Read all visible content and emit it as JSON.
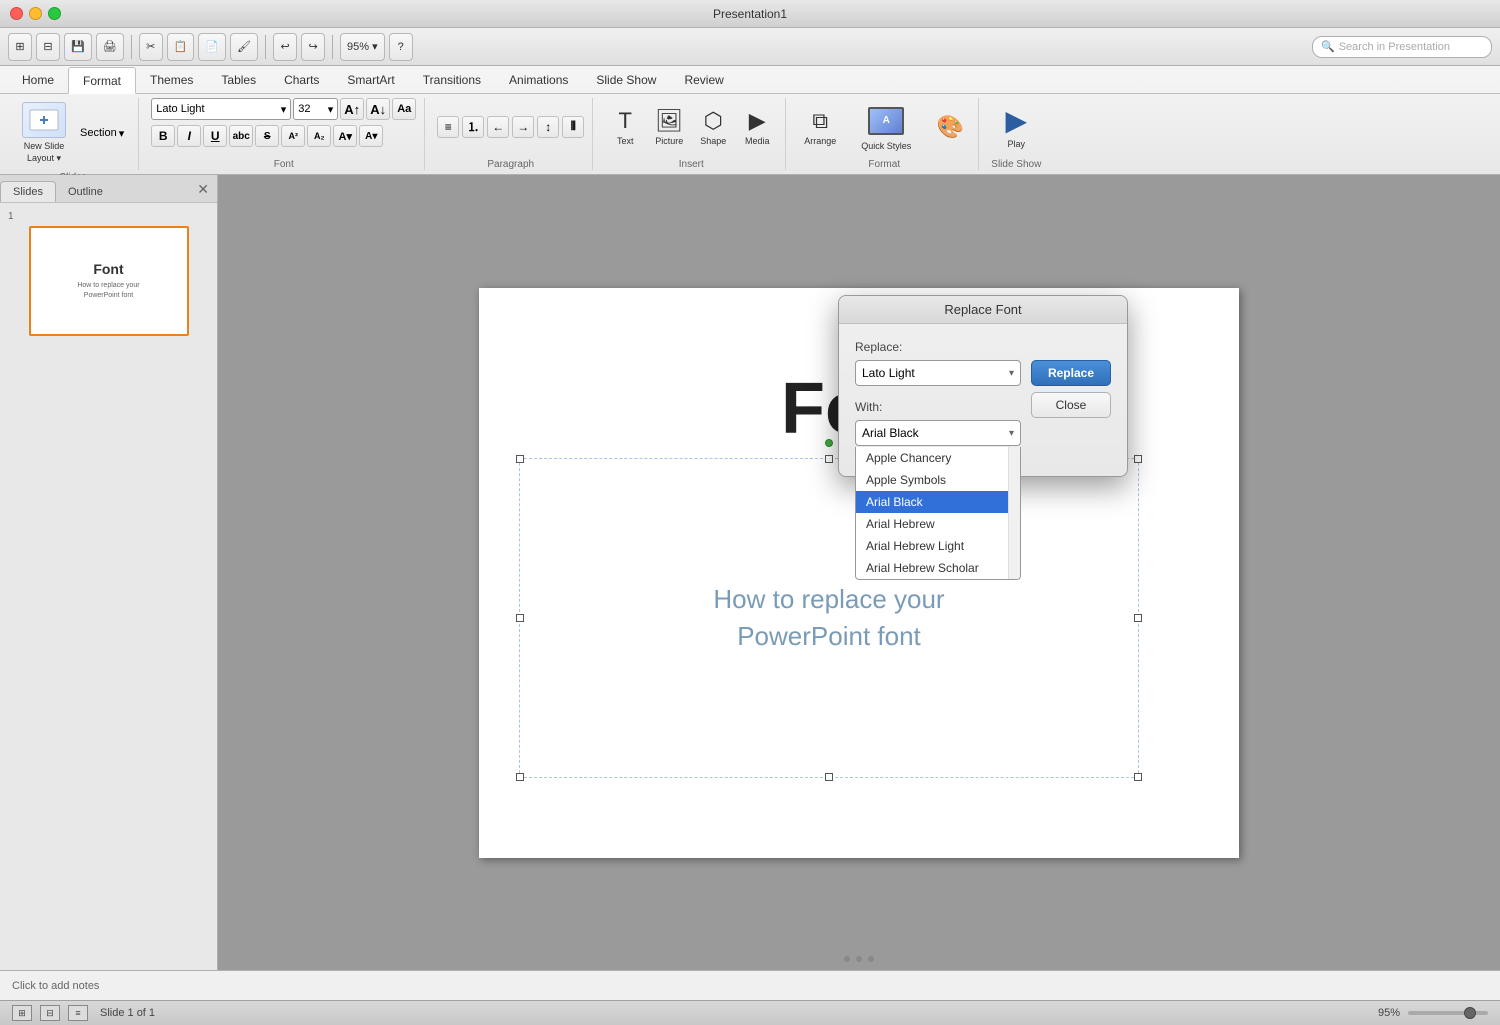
{
  "titlebar": {
    "title": "Presentation1",
    "close_label": "×",
    "min_label": "–",
    "max_label": "+"
  },
  "toolbar": {
    "buttons": [
      "⊞",
      "⊟",
      "💾",
      "🖨",
      "✂",
      "📋",
      "📄",
      "↩",
      "↪",
      "🔍",
      "95%",
      "?"
    ],
    "search_placeholder": "Search in Presentation"
  },
  "ribbon": {
    "tabs": [
      "Home",
      "Format",
      "Themes",
      "Tables",
      "Charts",
      "SmartArt",
      "Transitions",
      "Animations",
      "Slide Show",
      "Review"
    ],
    "active_tab": "Home",
    "groups": {
      "slides": {
        "label": "Slides",
        "new_slide": "New Slide",
        "layout": "Layout",
        "section": "Section"
      },
      "font": {
        "label": "Font",
        "name": "Lato Light",
        "size": "32",
        "bold": "B",
        "italic": "I",
        "underline": "U",
        "shadow": "S",
        "strikethrough": "abc"
      },
      "paragraph": {
        "label": "Paragraph"
      },
      "insert": {
        "label": "Insert",
        "text": "Text",
        "picture": "Picture",
        "shape": "Shape",
        "media": "Media"
      },
      "format": {
        "label": "Format",
        "arrange": "Arrange",
        "quick_styles": "Quick Styles"
      },
      "slideshow": {
        "label": "Slide Show",
        "play": "Play"
      }
    }
  },
  "slides_panel": {
    "tabs": [
      "Slides",
      "Outline"
    ],
    "active_tab": "Slides",
    "slides": [
      {
        "number": "1",
        "title": "Font",
        "subtitle": "How to replace your\nPowerPoint font"
      }
    ]
  },
  "canvas": {
    "slide": {
      "title": "Font",
      "text_content": "How to replace your\nPowerPoint font"
    }
  },
  "notes_bar": {
    "placeholder": "Click to add notes"
  },
  "status_bar": {
    "slide_info": "Slide 1 of 1",
    "zoom": "95%"
  },
  "replace_font_dialog": {
    "title": "Replace Font",
    "replace_label": "Replace:",
    "replace_value": "Lato Light",
    "with_label": "With:",
    "with_value": "Arial Black",
    "replace_btn": "Replace",
    "close_btn": "Close",
    "dropdown_items": [
      "Apple Chancery",
      "Apple Symbols",
      "Arial Black",
      "Arial Hebrew",
      "Arial Hebrew Light",
      "Arial Hebrew Scholar"
    ],
    "selected_item": "Arial Black"
  }
}
